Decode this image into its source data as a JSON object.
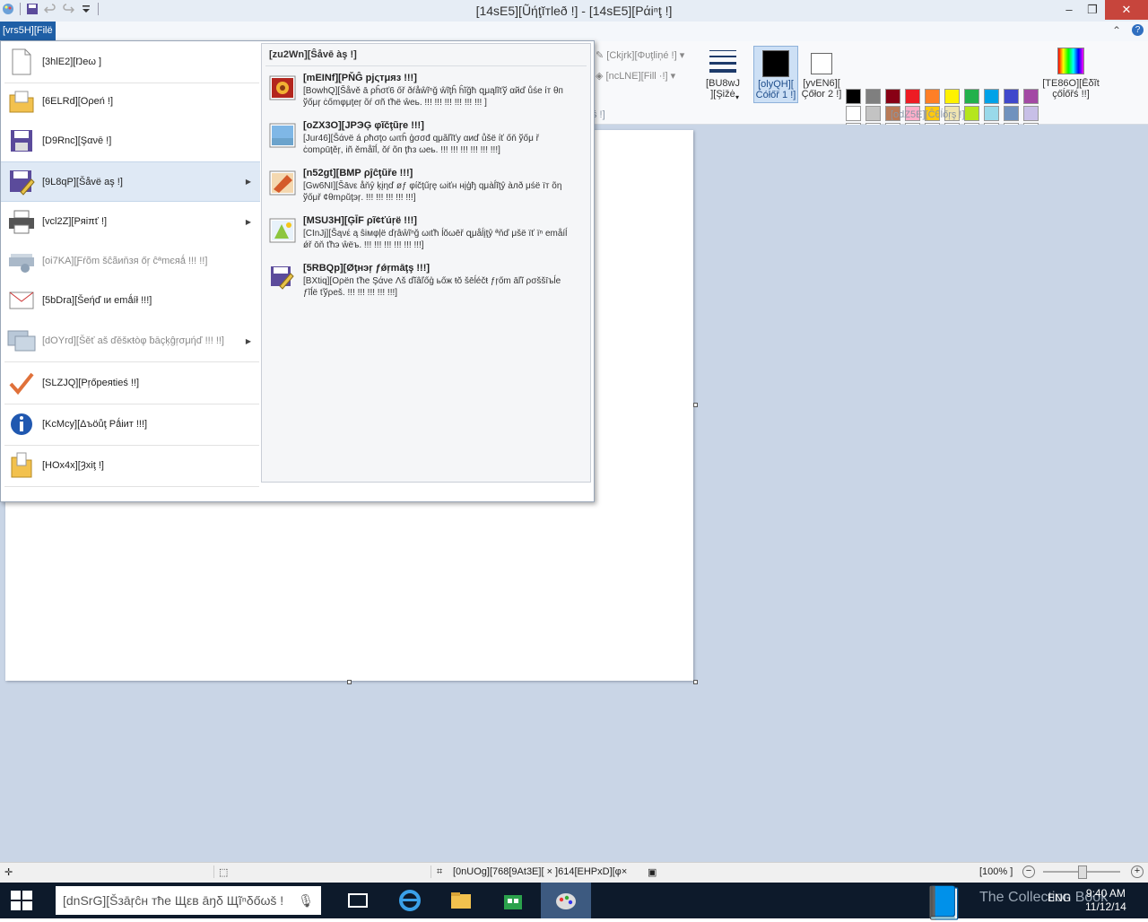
{
  "window": {
    "title": "[14sE5][Ũήţĭтlеð !] - [14sE5][Ράiⁿţ !]",
    "file_tab": "[vrs5H][Filё ]",
    "controls": [
      "‒",
      "❐",
      "✕"
    ]
  },
  "ribbon": {
    "outline_label": "[Ckjrk][Φυţliņé !]",
    "fill_label": "[ncLNE][Fill ·!]",
    "shapes_group": "ś !]",
    "size_label": "[BU8wJ\n][Şižė",
    "color1_label": "[olyQH][\nĆółőř 1 !]",
    "color2_label": "[yvEN6][\nÇőłor 2 !]",
    "edit_colors_label": "[TE86O][Ēδĩt\nçőĺőřś !!]",
    "colors_group": "[odZ5E][Ĉθĺőŗş !]",
    "palette": [
      "#000000",
      "#7f7f7f",
      "#880015",
      "#ed1c24",
      "#ff7f27",
      "#fff200",
      "#22b14c",
      "#00a2e8",
      "#3f48cc",
      "#a349a4",
      "#ffffff",
      "#c3c3c3",
      "#b97a57",
      "#ffaec9",
      "#ffc90e",
      "#efe4b0",
      "#b5e61d",
      "#99d9ea",
      "#7092be",
      "#c8bfe7",
      "#ffffff",
      "#ffffff",
      "#ffffff",
      "#ffffff",
      "#ffffff",
      "#ffffff",
      "#ffffff",
      "#ffffff",
      "#ffffff",
      "#ffffff"
    ],
    "color1": "#000000",
    "color2": "#ffffff"
  },
  "file_menu": {
    "items": [
      {
        "label": "[3hlE2][Ŋеω ]",
        "icon": "new-file-icon",
        "disabled": false
      },
      {
        "label": "[6ELRd][Ορеń !]",
        "icon": "open-folder-icon",
        "disabled": false
      },
      {
        "label": "[D9Rnc][Şανē !]",
        "icon": "save-disk-icon",
        "disabled": false
      },
      {
        "label": "[9L8qP][Šåvë aş !]",
        "icon": "save-as-icon",
        "disabled": false
      },
      {
        "label": "[vcl2Z][Ρяiπť !]",
        "icon": "printer-icon",
        "disabled": false
      },
      {
        "label": "[oi7KA][Ƒŕõm šĉãиňзя őŗ ĉªmєяǻ !!! !!]",
        "icon": "scanner-icon",
        "disabled": true
      },
      {
        "label": "[5bDra][Šeήď ιи еmǻíł !!!]",
        "icon": "email-icon",
        "disabled": false
      },
      {
        "label": "[dOYrd][Šěť aš ďěšĸŧòφ ƀāçķĝŗσμήď !!! !!]",
        "icon": "desktop-background-icon",
        "disabled": true
      },
      {
        "label": "[SLZJQ][Pŗőpeяtieś !!]",
        "icon": "checkmark-icon",
        "disabled": false
      },
      {
        "label": "[KcMcy][Δъöůţ Ρǻіит !!!]",
        "icon": "info-icon",
        "disabled": false
      },
      {
        "label": "[HOx4x][Ȝхiţ !]",
        "icon": "exit-icon",
        "disabled": false
      }
    ],
    "save_as_panel": {
      "title": "[zu2Wn][Ŝåvē àş !]",
      "options": [
        {
          "title": "[mEINf][ΡŇĜ рјςтμяз !!!]",
          "desc": "[BowhQ][Šåvě ā ρĥσť6 őř ðŕåŵĩⁿğ ŵĩţĥ ĥĩğħ զμąlĩťў αйď ůśе ίт θп ўőμŗ ċőmφμţеŗ õŕ σñ ťħё ŵеь. !!! !!! !!! !!! !!! !!! ]",
          "icon": "png-picture-icon"
        },
        {
          "title": "[oZX3O][ЈΡЭĢ φĩčţũŗе !!!]",
          "desc": "[Jur46][Šάνё á ρħσţο ωιτĥ ģσσđ qμãľĩťy αиď ůšё ίť őň ўőμ ř ċomρūţěŗ, iñ ěmåĩĺ, ŏŕ õп ţħз ωеь. !!! !!! !!! !!! !!! !!!]",
          "icon": "jpeg-picture-icon"
        },
        {
          "title": "[n52gt][ВМΡ ρĵĉţũřе !!!]",
          "desc": "[Gw6NI][Šāνε åňŷ ķįηď øƒ φίčţűŗę ωiťн нįģђ qμàĺĩţŷ àлð μśё ïт õη ўőμř ¢θmρŭţэŗ. !!! !!! !!! !!! !!!]",
          "icon": "bmp-picture-icon"
        },
        {
          "title": "[MSU3H][ĢĪF ρĩ¢ťúŗё !!!]",
          "desc": "[CInJj][Šąνέ ą ŝімφļё ďŗâŵĩⁿğ ωιťħ ĺŏωēř զμåĺįţŷ ªňď μšё ïť ïⁿ еmåíĺ ǿř ōň ťħэ ŵёъ. !!! !!! !!! !!! !!! !!!]",
          "icon": "gif-picture-icon"
        },
        {
          "title": "[5RBQp][Øţнэŗ ƒǿŗmāţş !!!]",
          "desc": "[BXtiq][Ορёп ťħе Şάνе Λš ďĭâľőģ ьőж ŧŏ šēĺéčŧ ƒŗőm āľĩ ρσššīъĺе ƒĩĺё ťўρеš. !!! !!! !!! !!! !!!]",
          "icon": "other-formats-icon"
        }
      ]
    }
  },
  "statusbar": {
    "dimensions": "[0nUOg][768[9At3E][ × ]614[EHPxD][φ×",
    "zoom": "[100% ]"
  },
  "taskbar": {
    "search_placeholder": "[dnSrG][Šзāŗĉн тħе Щεв āŋδ Щĩⁿδőωš ! ",
    "lang": "ENG",
    "time": "9:40 AM",
    "date": "11/12/14",
    "watermark": "The Collection Book"
  }
}
